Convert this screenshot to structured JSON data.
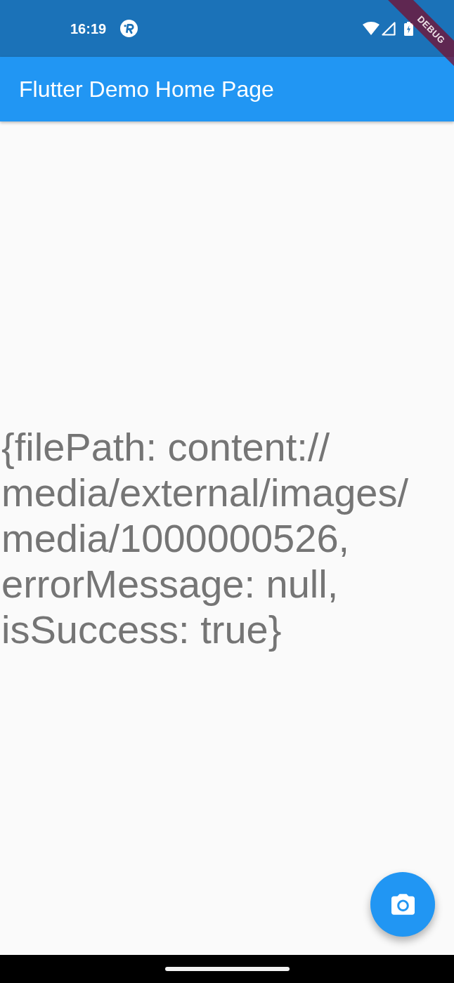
{
  "status_bar": {
    "time": "16:19"
  },
  "debug_banner": {
    "label": "DEBUG"
  },
  "app_bar": {
    "title": "Flutter Demo Home Page"
  },
  "body": {
    "result": "{filePath: content://media/external/images/media/1000000526, errorMessage: null, isSuccess: true}"
  }
}
